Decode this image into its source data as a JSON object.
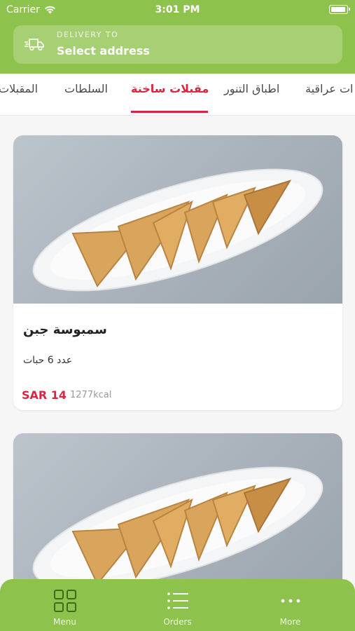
{
  "status_bar": {
    "carrier": "Carrier",
    "time": "3:01 PM"
  },
  "delivery": {
    "label": "DELIVERY TO",
    "value": "Select address"
  },
  "tabs": [
    {
      "label": "ات عراقية"
    },
    {
      "label": "اطباق التنور"
    },
    {
      "label": "مقبلات ساخنة",
      "active": true
    },
    {
      "label": "السلطات"
    },
    {
      "label": "المقبلات"
    }
  ],
  "items": [
    {
      "name": "سمبوسة جبن",
      "description": "عدد 6 حبات",
      "price": "SAR 14",
      "kcal": "1277kcal"
    },
    {
      "name": "",
      "description": "",
      "price": "",
      "kcal": ""
    }
  ],
  "bottom_nav": [
    {
      "label": "Menu",
      "icon": "grid-icon"
    },
    {
      "label": "Orders",
      "icon": "list-icon"
    },
    {
      "label": "More",
      "icon": "more-icon"
    }
  ],
  "colors": {
    "brand": "#8dc34c",
    "accent": "#d7263d"
  }
}
